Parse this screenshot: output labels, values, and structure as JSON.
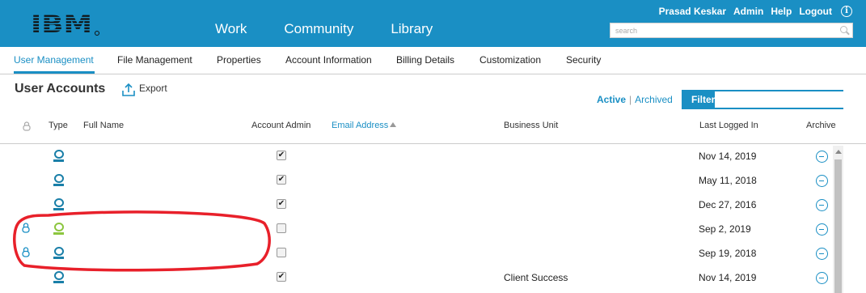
{
  "header": {
    "nav": [
      "Work",
      "Community",
      "Library"
    ],
    "user_links": [
      "Prasad Keskar",
      "Admin",
      "Help",
      "Logout"
    ],
    "search_placeholder": "search",
    "info_glyph": "i"
  },
  "subnav": {
    "tabs": [
      "User Management",
      "File Management",
      "Properties",
      "Account Information",
      "Billing Details",
      "Customization",
      "Security"
    ],
    "active_tab": "User Management"
  },
  "section": {
    "title": "User Accounts",
    "export_label": "Export",
    "status_active": "Active",
    "status_separator": "|",
    "status_archived": "Archived",
    "filter_label": "Filter",
    "filter_value": ""
  },
  "table": {
    "columns": {
      "type": "Type",
      "full_name": "Full Name",
      "account_admin": "Account Admin",
      "email": "Email Address",
      "business_unit": "Business Unit",
      "last_logged_in": "Last Logged In",
      "archive": "Archive"
    },
    "sorted_by": "Email Address",
    "sort_direction": "ascending",
    "rows": [
      {
        "locked": false,
        "user_type_color": "#1a7fa8",
        "full_name": "",
        "account_admin": true,
        "email": "",
        "business_unit": "",
        "last_logged_in": "Nov 14, 2019"
      },
      {
        "locked": false,
        "user_type_color": "#1a7fa8",
        "full_name": "",
        "account_admin": true,
        "email": "",
        "business_unit": "",
        "last_logged_in": "May 11, 2018"
      },
      {
        "locked": false,
        "user_type_color": "#1a7fa8",
        "full_name": "",
        "account_admin": true,
        "email": "",
        "business_unit": "",
        "last_logged_in": "Dec 27, 2016"
      },
      {
        "locked": true,
        "user_type_color": "#8cc63f",
        "full_name": "",
        "account_admin": false,
        "email": "",
        "business_unit": "",
        "last_logged_in": "Sep 2, 2019"
      },
      {
        "locked": true,
        "user_type_color": "#1a7fa8",
        "full_name": "",
        "account_admin": false,
        "email": "",
        "business_unit": "",
        "last_logged_in": "Sep 19, 2018"
      },
      {
        "locked": false,
        "user_type_color": "#1a7fa8",
        "full_name": "",
        "account_admin": true,
        "email": "",
        "business_unit": "Client Success",
        "last_logged_in": "Nov 14, 2019"
      }
    ]
  },
  "colors": {
    "brand_blue": "#1a8fc4",
    "external_user_green": "#8cc63f",
    "annotation_red": "#e8202a"
  },
  "icons": {
    "logo": "ibm-logo",
    "info": "info-icon",
    "search": "search-icon",
    "export": "export-icon",
    "lock": "lock-icon",
    "user": "user-icon",
    "archive": "archive-icon"
  }
}
